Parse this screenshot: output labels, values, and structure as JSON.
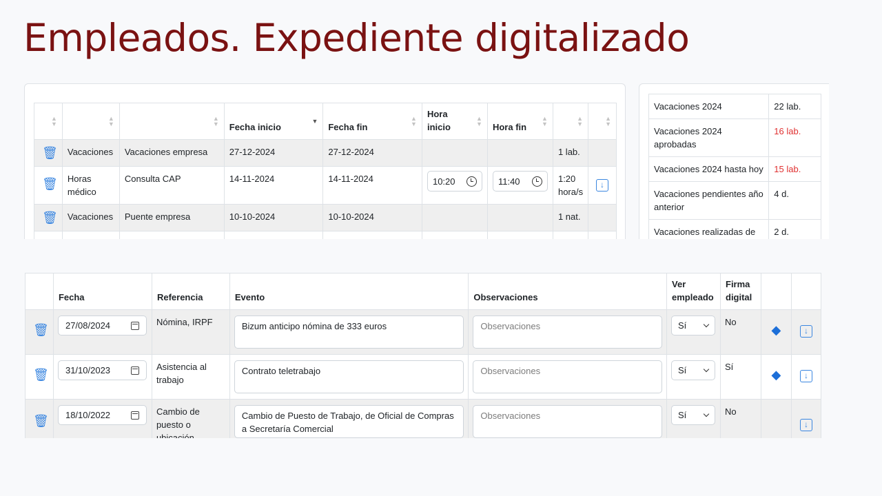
{
  "page": {
    "title": "Empleados. Expediente digitalizado"
  },
  "leave_table": {
    "headers": [
      "",
      "",
      "",
      "Fecha inicio",
      "Fecha fin",
      "Hora inicio",
      "Hora fin",
      "",
      ""
    ],
    "rows": [
      {
        "type": "Vacaciones",
        "description": "Vacaciones empresa",
        "start": "27-12-2024",
        "end": "27-12-2024",
        "hour_start": "",
        "hour_end": "",
        "duration": "1 lab.",
        "has_download": false
      },
      {
        "type": "Horas médico",
        "description": "Consulta CAP",
        "start": "14-11-2024",
        "end": "14-11-2024",
        "hour_start": "10:20",
        "hour_end": "11:40",
        "duration": "1:20 hora/s",
        "has_download": true
      },
      {
        "type": "Vacaciones",
        "description": "Puente empresa",
        "start": "10-10-2024",
        "end": "10-10-2024",
        "hour_start": "",
        "hour_end": "",
        "duration": "1 nat.",
        "has_download": false
      }
    ]
  },
  "summary": {
    "rows": [
      {
        "label": "Vacaciones 2024",
        "value": "22 lab.",
        "highlight": false
      },
      {
        "label": "Vacaciones 2024 aprobadas",
        "value": "16 lab.",
        "highlight": true
      },
      {
        "label": "Vacaciones 2024 hasta hoy",
        "value": "15 lab.",
        "highlight": true
      },
      {
        "label": "Vacaciones pendientes año anterior",
        "value": "4 d.",
        "highlight": false
      },
      {
        "label": "Vacaciones realizadas de las pendientes del año anterior",
        "value": "2 d.",
        "highlight": false
      }
    ],
    "highlight_color": "#e03131"
  },
  "documents": {
    "headers": {
      "fecha": "Fecha",
      "referencia": "Referencia",
      "evento": "Evento",
      "observaciones": "Observaciones",
      "ver_empleado": "Ver empleado",
      "firma_digital": "Firma digital"
    },
    "observaciones_placeholder": "Observaciones",
    "rows": [
      {
        "fecha": "27/08/2024",
        "referencia": "Nómina, IRPF",
        "evento": "Bizum anticipo nómina de 333 euros",
        "ver": "Sí",
        "firma": "No",
        "has_layers": true
      },
      {
        "fecha": "31/10/2023",
        "referencia": "Asistencia al trabajo",
        "evento": "Contrato teletrabajo",
        "ver": "Sí",
        "firma": "Sí",
        "has_layers": true
      },
      {
        "fecha": "18/10/2022",
        "referencia": "Cambio de puesto o ubicación",
        "evento": "Cambio de Puesto de Trabajo, de Oficial de Compras a Secretaría Comercial",
        "ver": "Sí",
        "firma": "No",
        "has_layers": false
      }
    ]
  },
  "icons": {
    "delete": "trash-icon",
    "download": "download-icon",
    "time": "clock-icon",
    "date": "calendar-icon",
    "select": "chevron-down-icon",
    "layers": "layers-icon",
    "sort": "sort-icon"
  },
  "colors": {
    "title": "#7a1212",
    "accent": "#3a86e0",
    "stripe": "#efefef"
  }
}
